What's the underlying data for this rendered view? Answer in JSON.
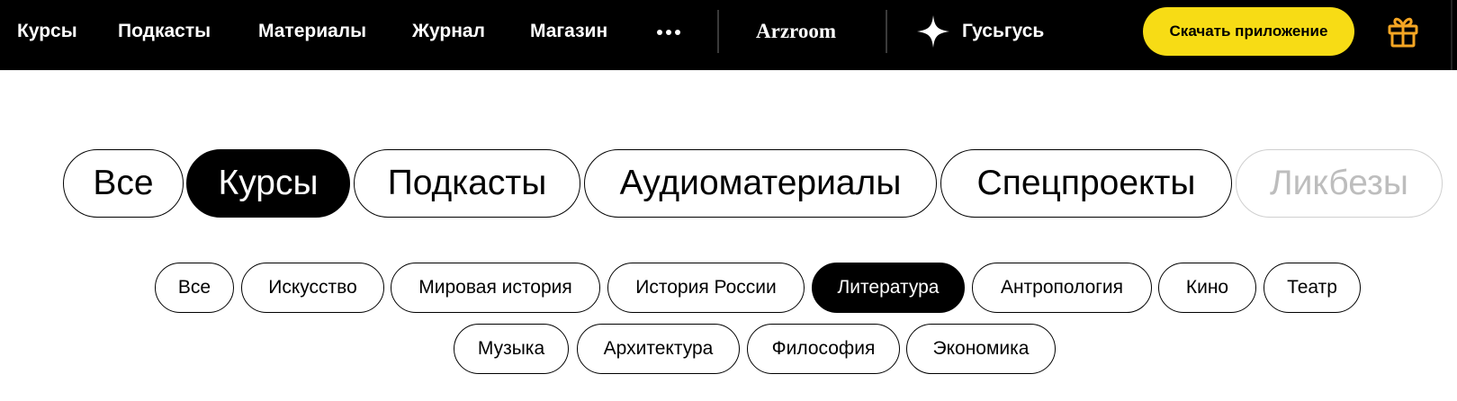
{
  "nav": {
    "links": [
      "Курсы",
      "Подкасты",
      "Материалы",
      "Журнал",
      "Магазин"
    ],
    "more_icon": "more-dots-icon",
    "brand_arzroom": "Arzroom",
    "brand_gusgus": "Гусьгусь",
    "gusgus_icon": "sparkle-star-icon",
    "download_label": "Скачать приложение",
    "gift_icon": "gift-icon"
  },
  "colors": {
    "topbar_bg": "#000000",
    "accent_yellow": "#f7dc15",
    "gift_orange": "#f5a623",
    "active_pill_bg": "#000000",
    "faded_text": "#bdbdbd"
  },
  "primary_filters": {
    "items": [
      "Все",
      "Курсы",
      "Подкасты",
      "Аудиоматериалы",
      "Спецпроекты",
      "Ликбезы"
    ],
    "selected": "Курсы"
  },
  "subject_filters": {
    "items": [
      "Все",
      "Искусство",
      "Мировая история",
      "История России",
      "Литература",
      "Антропология",
      "Кино",
      "Театр",
      "Музыка",
      "Архитектура",
      "Философия",
      "Экономика"
    ],
    "selected": "Литература"
  }
}
